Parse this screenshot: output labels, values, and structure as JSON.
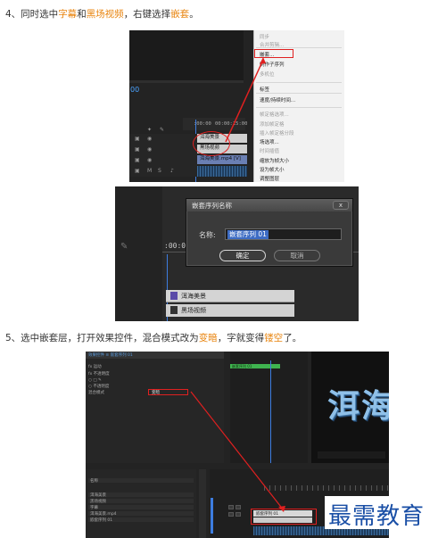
{
  "step1": {
    "prefix": "4、同时选中",
    "hl1": "字幕",
    "and": "和",
    "hl2": "黑场视频",
    "mid": "，右键选择",
    "hl3": "嵌套",
    "end": "。"
  },
  "step2": {
    "prefix": "5、选中嵌套层，打开效果控件，混合模式改为",
    "hl1": "变暗",
    "mid": "，字就变得",
    "hl2": "镂空",
    "end": "了。"
  },
  "shot1": {
    "timecode_left": "00",
    "ruler_times": [
      ":00:00",
      "00:00:15:00"
    ],
    "clips": [
      "洱海美景",
      "黑场视频",
      "洱海美景.mp4 [V]"
    ],
    "context_menu": [
      {
        "label": "同步",
        "dim": true
      },
      {
        "label": "合并剪辑...",
        "dim": true
      },
      {
        "label": "嵌套...",
        "dim": false
      },
      {
        "label": "制作子序列",
        "dim": false
      },
      {
        "label": "多机位",
        "dim": true
      },
      {
        "label": "标签",
        "dim": false
      },
      {
        "label": "速度/持续时间...",
        "dim": false
      },
      {
        "label": "帧定格选项...",
        "dim": true
      },
      {
        "label": "添加帧定格",
        "dim": true
      },
      {
        "label": "插入帧定格分段",
        "dim": true
      },
      {
        "label": "场选项...",
        "dim": false
      },
      {
        "label": "时间插值",
        "dim": true
      },
      {
        "label": "缩放为帧大小",
        "dim": false
      },
      {
        "label": "设为帧大小",
        "dim": false
      },
      {
        "label": "调整图层",
        "dim": false
      }
    ]
  },
  "shot2": {
    "timecode": ":00:00",
    "dialog_title": "嵌套序列名称",
    "close_label": "x",
    "name_label": "名称:",
    "name_value": "嵌套序列 01",
    "ok_label": "确定",
    "cancel_label": "取消",
    "clips": [
      "洱海美景",
      "黑场视频"
    ]
  },
  "shot3": {
    "ec_tab": "效果控件 ≡   嵌套序列 01",
    "ec_rows": [
      "fx 运动",
      "fx 不透明度",
      "○ □ ✎",
      "○ 不透明度",
      "混合模式"
    ],
    "blend_value": "变暗",
    "prog_label": "嵌套序列 01",
    "preview_text": "洱海",
    "proj_rows": [
      "名称",
      "洱海美景",
      "黑场视频",
      "字幕",
      "洱海美景.mp4",
      "嵌套序列 01"
    ],
    "tl_clip": "嵌套序列 01"
  },
  "watermark": "最需教育"
}
